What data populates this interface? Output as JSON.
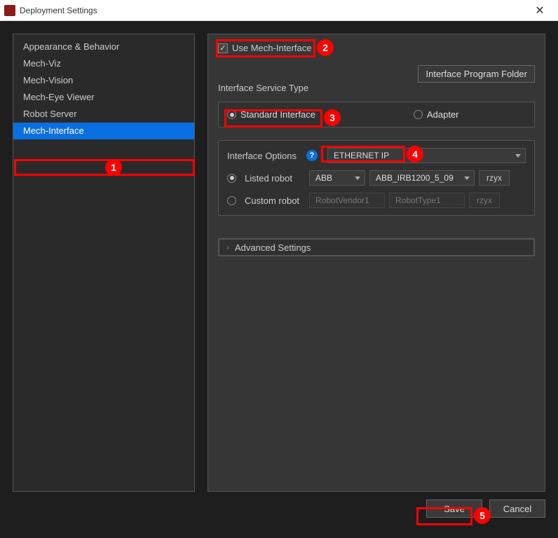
{
  "window": {
    "title": "Deployment Settings"
  },
  "sidebar": {
    "items": [
      {
        "label": "Appearance & Behavior"
      },
      {
        "label": "Mech-Viz"
      },
      {
        "label": "Mech-Vision"
      },
      {
        "label": "Mech-Eye Viewer"
      },
      {
        "label": "Robot Server"
      },
      {
        "label": "Mech-Interface",
        "selected": true
      }
    ]
  },
  "main": {
    "use_mech_interface_label": "Use Mech-Interface",
    "interface_program_folder_btn": "Interface Program Folder",
    "interface_service_type_label": "Interface Service Type",
    "service_types": {
      "standard": "Standard Interface",
      "adapter": "Adapter"
    },
    "interface_options_label": "Interface Options",
    "interface_options_value": "ETHERNET IP",
    "listed_robot_label": "Listed robot",
    "listed_robot_vendor": "ABB",
    "listed_robot_model": "ABB_IRB1200_5_09",
    "listed_robot_euler": "rzyx",
    "custom_robot_label": "Custom robot",
    "custom_robot_vendor": "RobotVendor1",
    "custom_robot_type": "RobotType1",
    "custom_robot_euler": "rzyx",
    "advanced_settings_label": "Advanced Settings"
  },
  "buttons": {
    "save": "Save",
    "cancel": "Cancel"
  },
  "annotations": {
    "n1": "1",
    "n2": "2",
    "n3": "3",
    "n4": "4",
    "n5": "5"
  }
}
